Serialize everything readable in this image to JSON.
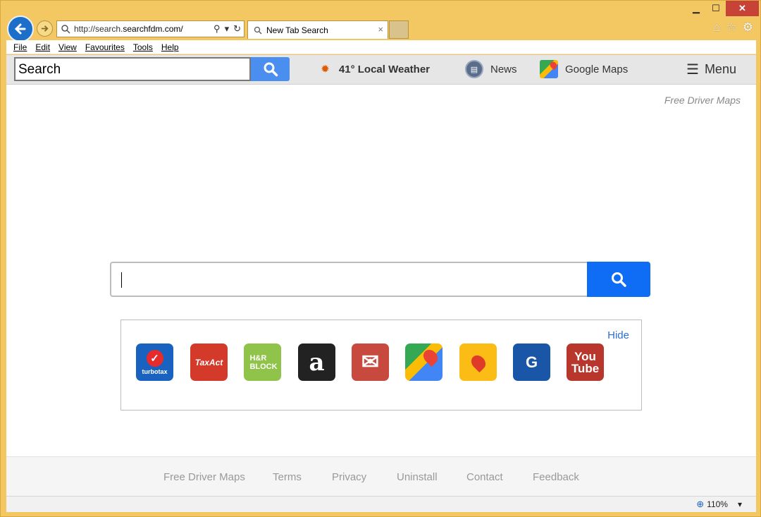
{
  "browser": {
    "address_url_prefix": "http://search.",
    "address_url_domain": "searchfdm.com/",
    "tab_title": "New Tab Search",
    "tab_close": "×",
    "window_min": "▁",
    "window_max": "☐",
    "window_close": "✕"
  },
  "menubar": {
    "items": [
      "File",
      "Edit",
      "View",
      "Favourites",
      "Tools",
      "Help"
    ]
  },
  "toolbar": {
    "search_value": "Search",
    "weather_label": "41° Local Weather",
    "news_label": "News",
    "maps_label": "Google Maps",
    "menu_label": "Menu"
  },
  "page": {
    "brand_link": "Free Driver Maps",
    "hide_label": "Hide",
    "tiles": {
      "turbotax": "turbotax",
      "taxact": "TaxAct",
      "hrblock_line1": "H&R",
      "hrblock_line2": "BLOCK",
      "amazon": "a",
      "gmail": "✉",
      "gsm": "G",
      "youtube_line1": "You",
      "youtube_line2": "Tube"
    }
  },
  "footer": {
    "links": [
      "Free Driver Maps",
      "Terms",
      "Privacy",
      "Uninstall",
      "Contact",
      "Feedback"
    ]
  },
  "statusbar": {
    "zoom": "110%"
  },
  "colors": {
    "frame": "#f3c862",
    "search_button": "#0e6cf5",
    "toolbar_button": "#4a8ef0",
    "close_button": "#c84337"
  }
}
